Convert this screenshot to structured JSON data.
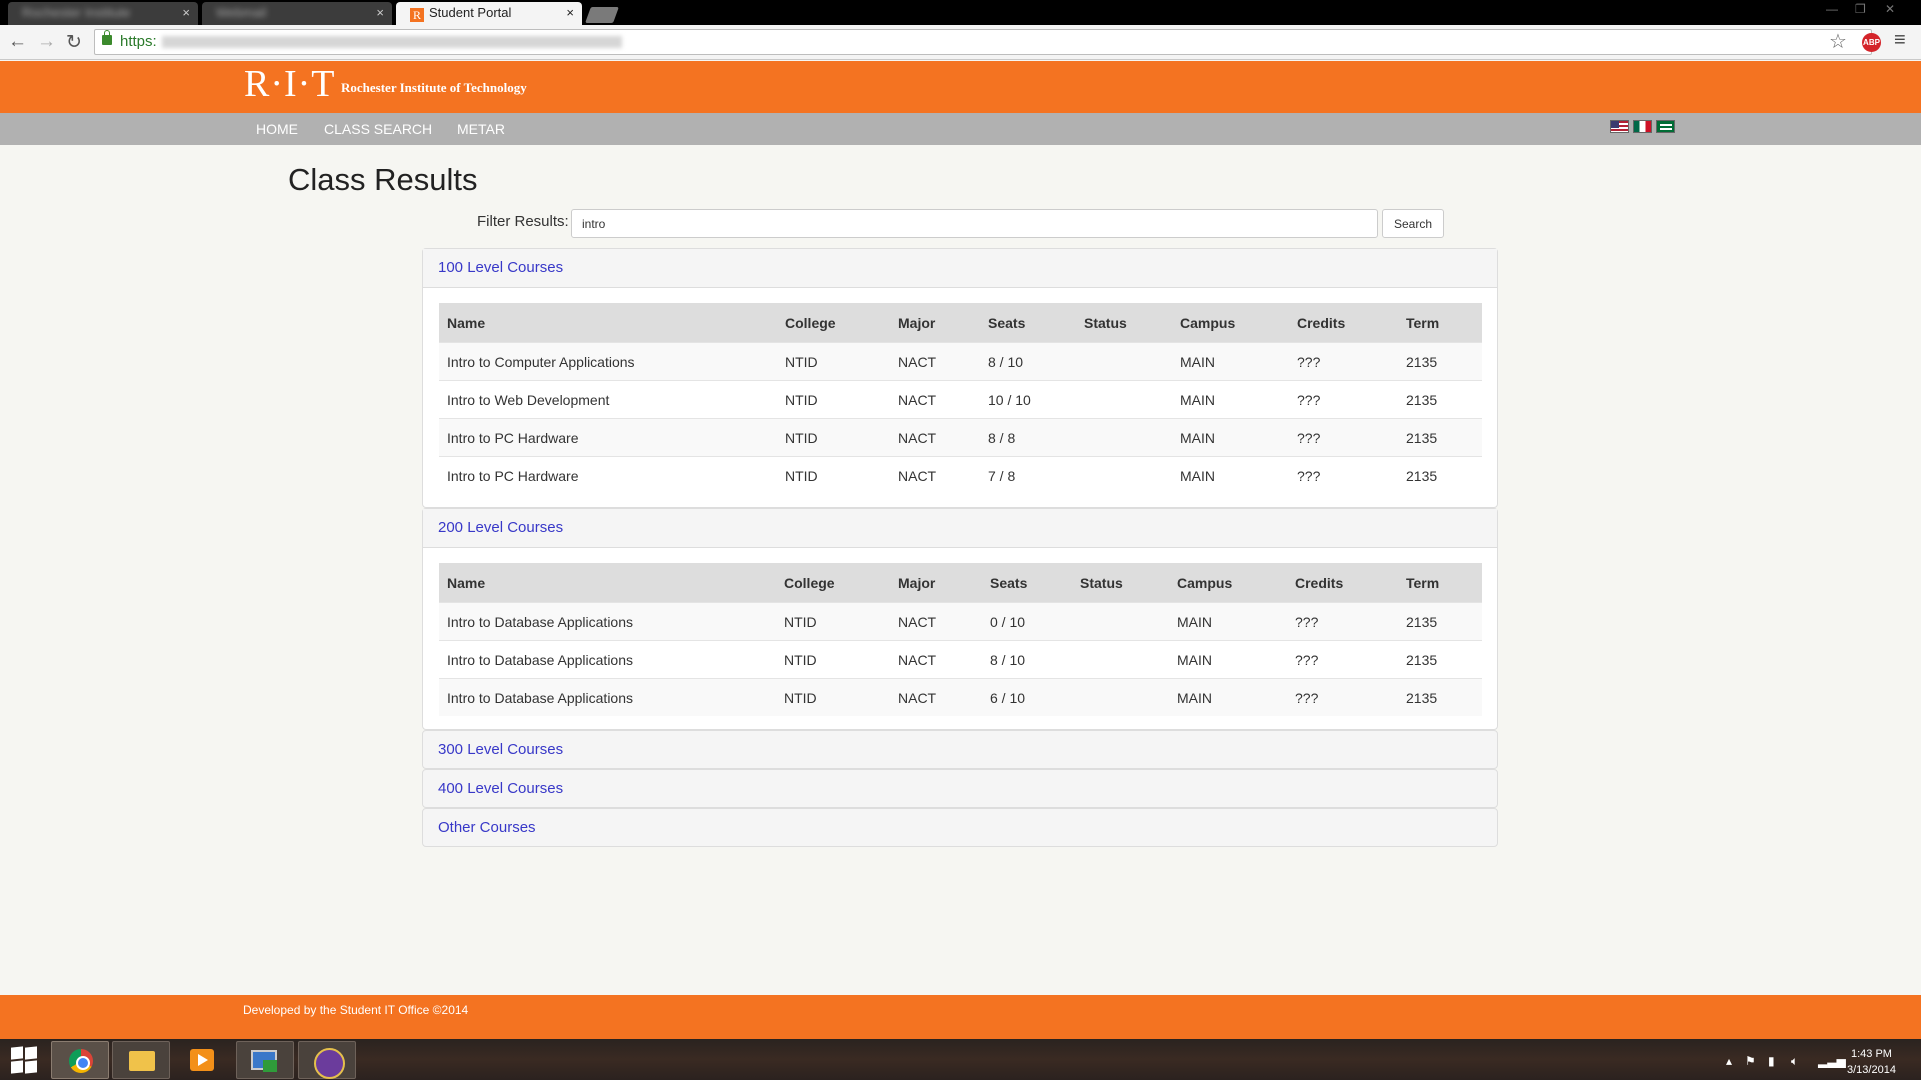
{
  "browser": {
    "tabs": [
      {
        "title": "Rochester Institute",
        "blurred": true
      },
      {
        "title": "Webmail",
        "blurred": true
      },
      {
        "title": "Student Portal",
        "active": true
      }
    ],
    "close_glyph": "×",
    "url_scheme": "https:",
    "icons": [
      "back-icon",
      "forward-icon",
      "reload-icon",
      "lock-icon",
      "star-icon",
      "adblock-icon",
      "menu-icon"
    ],
    "abp_label": "ABP"
  },
  "site": {
    "brand_color": "#f47321",
    "logo_mark": "R·I·T",
    "logo_text": "Rochester Institute of Technology",
    "nav": [
      "HOME",
      "CLASS SEARCH",
      "METAR"
    ],
    "flags": [
      "us-flag",
      "mexico-flag",
      "saudi-flag"
    ]
  },
  "page": {
    "title": "Class Results",
    "filter_label": "Filter Results:",
    "filter_value": "intro",
    "search_label": "Search"
  },
  "columns": [
    "Name",
    "College",
    "Major",
    "Seats",
    "Status",
    "Campus",
    "Credits",
    "Term"
  ],
  "sections": [
    {
      "title": "100 Level Courses",
      "expanded": true,
      "rows": [
        [
          "Intro to Computer Applications",
          "NTID",
          "NACT",
          "8 / 10",
          "",
          "MAIN",
          "???",
          "2135"
        ],
        [
          "Intro to Web Development",
          "NTID",
          "NACT",
          "10 / 10",
          "",
          "MAIN",
          "???",
          "2135"
        ],
        [
          "Intro to PC Hardware",
          "NTID",
          "NACT",
          "8 / 8",
          "",
          "MAIN",
          "???",
          "2135"
        ],
        [
          "Intro to PC Hardware",
          "NTID",
          "NACT",
          "7 / 8",
          "",
          "MAIN",
          "???",
          "2135"
        ]
      ]
    },
    {
      "title": "200 Level Courses",
      "expanded": true,
      "rows": [
        [
          "Intro to Database Applications",
          "NTID",
          "NACT",
          "0 / 10",
          "",
          "MAIN",
          "???",
          "2135"
        ],
        [
          "Intro to Database Applications",
          "NTID",
          "NACT",
          "8 / 10",
          "",
          "MAIN",
          "???",
          "2135"
        ],
        [
          "Intro to Database Applications",
          "NTID",
          "NACT",
          "6 / 10",
          "",
          "MAIN",
          "???",
          "2135"
        ]
      ]
    },
    {
      "title": "300 Level Courses",
      "expanded": false
    },
    {
      "title": "400 Level Courses",
      "expanded": false
    },
    {
      "title": "Other Courses",
      "expanded": false
    }
  ],
  "footer": {
    "text": "Developed by the Student IT Office ©2014"
  },
  "taskbar": {
    "apps": [
      "chrome-icon",
      "file-explorer-icon",
      "media-player-icon",
      "remote-desktop-icon",
      "java-ee-icon"
    ],
    "tray_icons": [
      "show-hidden-icon",
      "flag-icon",
      "power-icon",
      "volume-icon",
      "network-icon"
    ],
    "time": "1:43 PM",
    "date": "3/13/2014"
  }
}
